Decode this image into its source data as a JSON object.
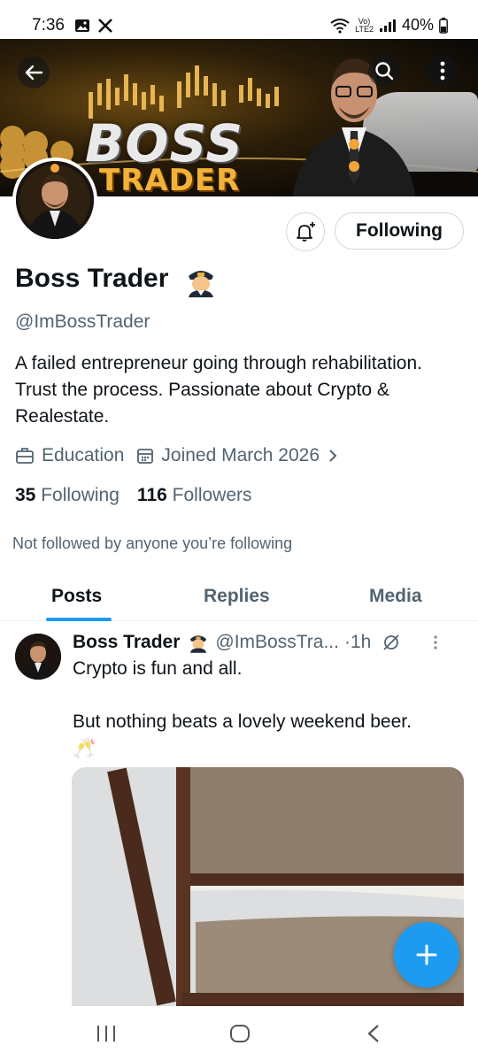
{
  "status_bar": {
    "time": "7:36",
    "network_label_top": "Vo)",
    "network_label_bottom": "LTE2",
    "battery": "40%"
  },
  "banner": {
    "title_line1": "BOSS",
    "title_line2": "TRADER"
  },
  "header_icons": {
    "back": "arrow-left-icon",
    "search": "search-icon",
    "more": "more-vertical-icon"
  },
  "profile": {
    "display_name": "Boss Trader",
    "handle": "@ImBossTrader",
    "bio": "A failed entrepreneur going through rehabilitation. Trust the process.  Passionate about Crypto & Realestate.",
    "category": "Education",
    "joined": "Joined March 2026",
    "following_count": "35",
    "following_label": "Following",
    "followers_count": "116",
    "followers_label": "Followers",
    "not_followed_text": "Not followed by anyone you’re following",
    "follow_button_label": "Following"
  },
  "tabs": [
    {
      "label": "Posts",
      "active": true
    },
    {
      "label": "Replies",
      "active": false
    },
    {
      "label": "Media",
      "active": false
    }
  ],
  "post": {
    "author_name": "Boss Trader",
    "author_handle": "@ImBossTra...",
    "time": "·1h",
    "text_line1": "Crypto is fun and all.",
    "text_line2": "But nothing beats a lovely weekend beer.",
    "text_line3": "🥂"
  },
  "colors": {
    "accent": "#1d9bf0",
    "text_primary": "#0f1419",
    "text_secondary": "#536471"
  }
}
